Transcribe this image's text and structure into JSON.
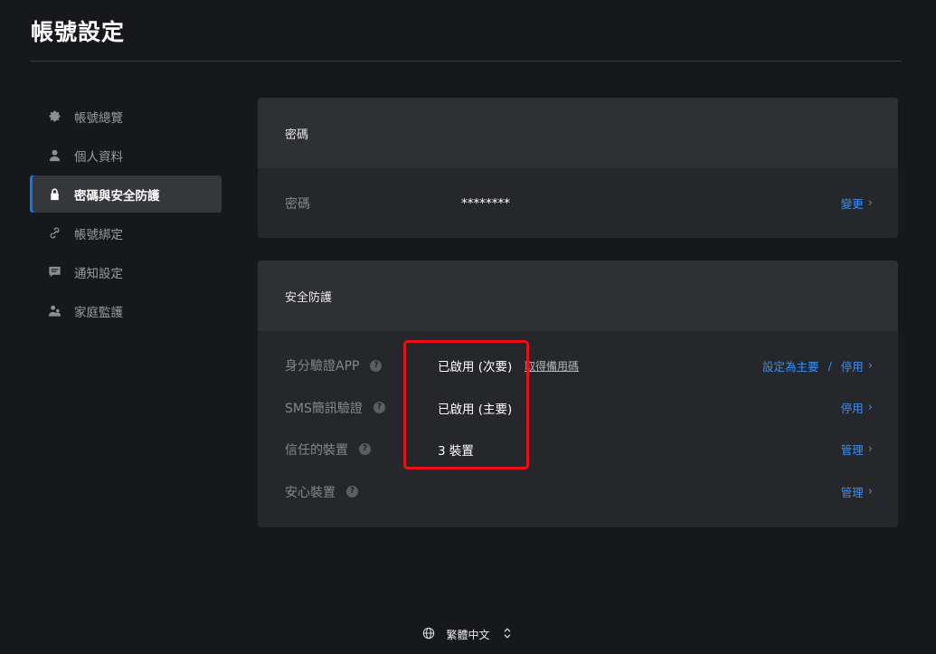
{
  "page": {
    "title": "帳號設定"
  },
  "sidebar": {
    "items": [
      {
        "label": "帳號總覽",
        "icon": "gear-icon",
        "active": false
      },
      {
        "label": "個人資料",
        "icon": "person-icon",
        "active": false
      },
      {
        "label": "密碼與安全防護",
        "icon": "lock-icon",
        "active": true
      },
      {
        "label": "帳號綁定",
        "icon": "link-icon",
        "active": false
      },
      {
        "label": "通知設定",
        "icon": "message-icon",
        "active": false
      },
      {
        "label": "家庭監護",
        "icon": "family-icon",
        "active": false
      }
    ]
  },
  "password_card": {
    "header": "密碼",
    "label": "密碼",
    "value": "********",
    "action": "變更"
  },
  "security_card": {
    "header": "安全防護",
    "rows": [
      {
        "label": "身分驗證APP",
        "value": "已啟用 (次要)",
        "extra_link": "取得備用碼",
        "action_primary": "設定為主要",
        "action": "停用"
      },
      {
        "label": "SMS簡訊驗證",
        "value": "已啟用 (主要)",
        "action": "停用"
      },
      {
        "label": "信任的裝置",
        "value": "3 裝置",
        "action": "管理"
      },
      {
        "label": "安心裝置",
        "value": "",
        "action": "管理"
      }
    ],
    "help_glyph": "?"
  },
  "footer": {
    "language": "繁體中文"
  },
  "colors": {
    "accent": "#1a73e8",
    "link": "#3d8ef0",
    "highlight": "#e8101a",
    "background": "#17181b"
  }
}
